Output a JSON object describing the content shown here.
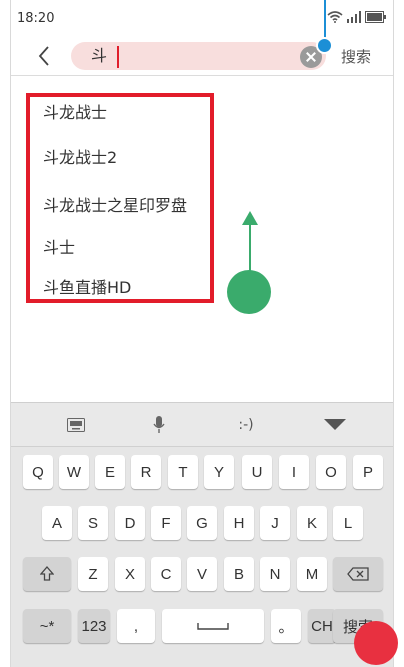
{
  "status_bar": {
    "time": "18:20",
    "wifi_icon": "wifi-icon",
    "signal_icon": "signal-icon",
    "battery_icon": "battery-icon"
  },
  "search": {
    "query": "斗",
    "action_label": "搜索",
    "back_icon": "back-arrow-icon",
    "clear_icon": "clear-icon"
  },
  "suggestions": [
    "斗龙战士",
    "斗龙战士2",
    "斗龙战士之星印罗盘",
    "斗士",
    "斗鱼直播HD"
  ],
  "keyboard": {
    "toolbar": {
      "keyboard_icon": "keyboard-icon",
      "mic_icon": "microphone-icon",
      "emoticon": ":-)",
      "collapse_icon": "triangle-down-icon"
    },
    "row1": [
      "Q",
      "W",
      "E",
      "R",
      "T",
      "Y",
      "U",
      "I",
      "O",
      "P"
    ],
    "row2": [
      "A",
      "S",
      "D",
      "F",
      "G",
      "H",
      "J",
      "K",
      "L"
    ],
    "row3": [
      "Z",
      "X",
      "C",
      "V",
      "B",
      "N",
      "M"
    ],
    "row4": {
      "symbols": "~*",
      "numbers": "123",
      "comma": ",",
      "period": "。",
      "lang": "CH",
      "enter": "搜索"
    }
  },
  "annotations": {
    "blue_color": "#1c8fd6",
    "red_color": "#e21c2a",
    "green_color": "#3aab6c"
  }
}
